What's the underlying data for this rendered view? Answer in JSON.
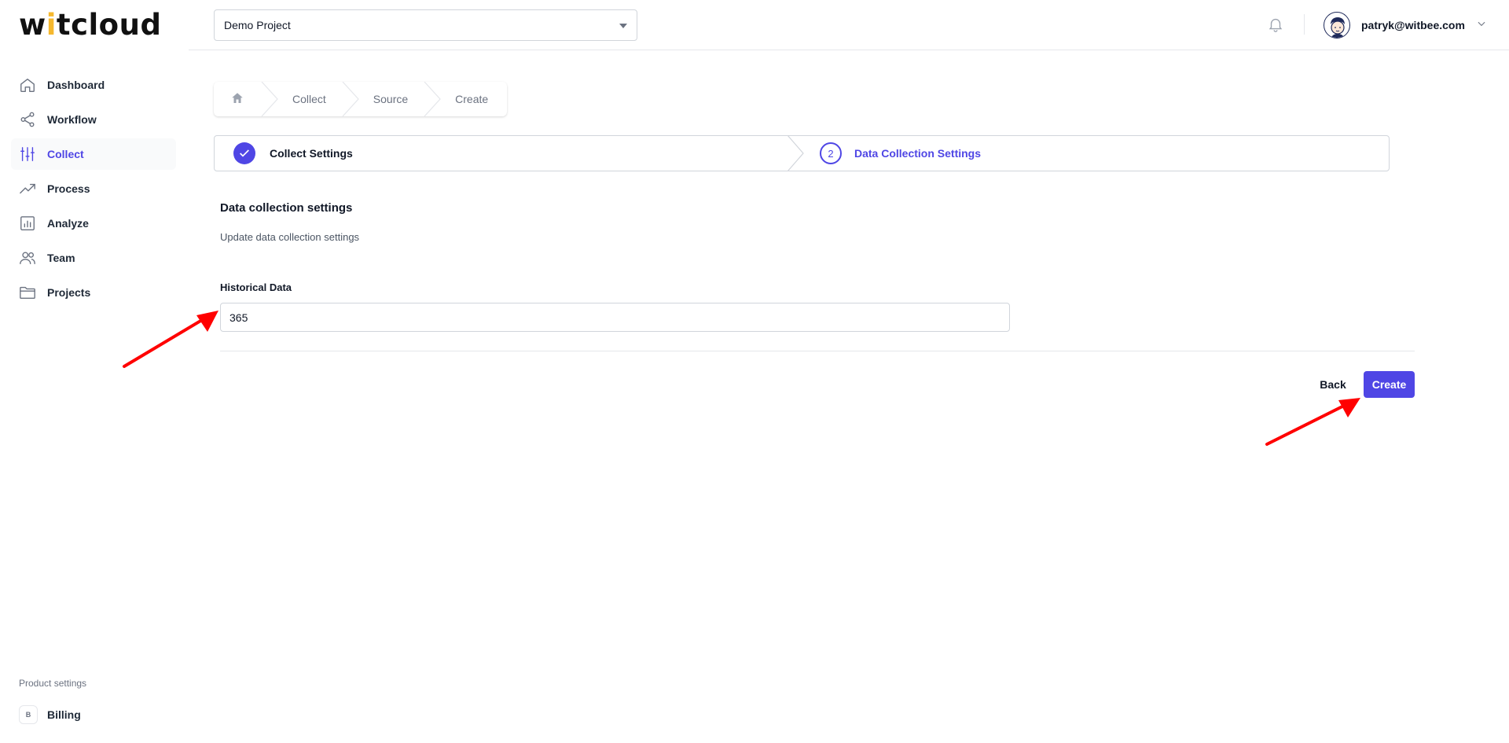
{
  "app": {
    "logo": {
      "part1": "w",
      "part2": "i",
      "part3": "t",
      "part4": "cloud"
    }
  },
  "header": {
    "project_select": {
      "value": "Demo Project"
    },
    "user": {
      "email": "patryk@witbee.com"
    }
  },
  "sidebar": {
    "items": [
      {
        "label": "Dashboard",
        "icon": "home-icon",
        "active": false
      },
      {
        "label": "Workflow",
        "icon": "share-icon",
        "active": false
      },
      {
        "label": "Collect",
        "icon": "sliders-icon",
        "active": true
      },
      {
        "label": "Process",
        "icon": "trend-icon",
        "active": false
      },
      {
        "label": "Analyze",
        "icon": "bar-chart-icon",
        "active": false
      },
      {
        "label": "Team",
        "icon": "users-icon",
        "active": false
      },
      {
        "label": "Projects",
        "icon": "folder-icon",
        "active": false
      }
    ],
    "product_settings_label": "Product settings",
    "billing": {
      "badge": "B",
      "label": "Billing"
    }
  },
  "breadcrumb": {
    "items": [
      "Collect",
      "Source",
      "Create"
    ]
  },
  "stepper": {
    "steps": [
      {
        "label": "Collect Settings",
        "state": "complete"
      },
      {
        "number": "2",
        "label": "Data Collection Settings",
        "state": "current"
      }
    ]
  },
  "form": {
    "title": "Data collection settings",
    "subtitle": "Update data collection settings",
    "historical_label": "Historical Data",
    "historical_value": "365",
    "back_label": "Back",
    "create_label": "Create"
  },
  "colors": {
    "accent": "#4f46e5",
    "logo_accent": "#f5b82e",
    "annotation_arrow": "#ff0000"
  }
}
